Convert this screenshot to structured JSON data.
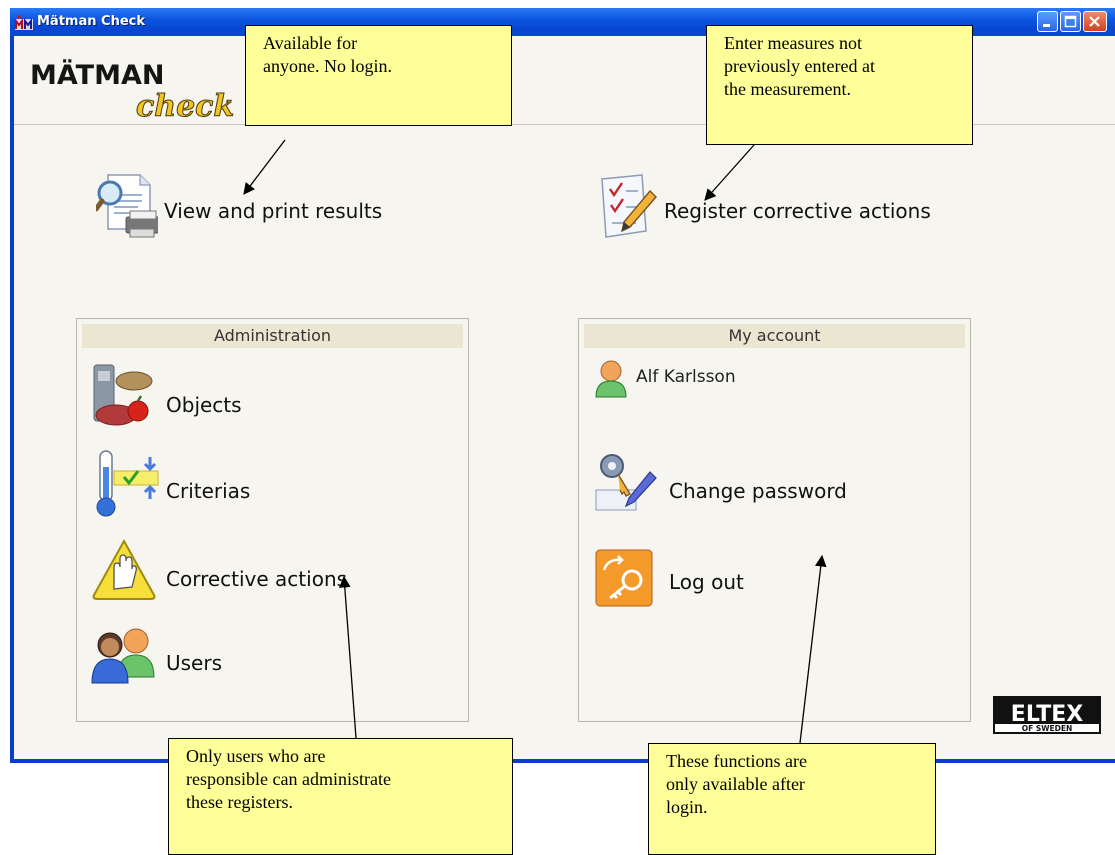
{
  "window": {
    "title": "Mätman Check",
    "controls": [
      "minimize",
      "maximize",
      "close"
    ]
  },
  "logo": {
    "line1": "MÄTMAN",
    "line2": "check"
  },
  "actions": {
    "view_print": "View and print results",
    "register_corrective": "Register corrective actions"
  },
  "administration": {
    "title": "Administration",
    "items": [
      {
        "label": "Objects",
        "icon": "objects-icon"
      },
      {
        "label": "Criterias",
        "icon": "thermometer-icon"
      },
      {
        "label": "Corrective actions",
        "icon": "warning-hand-icon"
      },
      {
        "label": "Users",
        "icon": "users-icon"
      }
    ]
  },
  "account": {
    "title": "My account",
    "user_name": "Alf Karlsson",
    "change_password": "Change password",
    "logout": "Log out"
  },
  "brand": {
    "name": "ELTEX",
    "sub": "OF SWEDEN"
  },
  "annotations": [
    "Available for anyone. No login.",
    "Enter measures not previously entered at the measurement.",
    "Only users who are responsible can administrate these registers.",
    "These functions are only available after login."
  ],
  "annotation_lines": {
    "a1": [
      "Available for",
      "anyone. No login."
    ],
    "a2": [
      "Enter measures not",
      "previously entered at",
      "the measurement."
    ],
    "a3": [
      "Only users who are",
      "responsible can administrate",
      "these registers."
    ],
    "a4": [
      "These functions are",
      "only available after",
      "login."
    ]
  },
  "colors": {
    "titlebar": "#0c56e0",
    "client_bg": "#f6f5ef",
    "note_bg": "#ffff99"
  }
}
